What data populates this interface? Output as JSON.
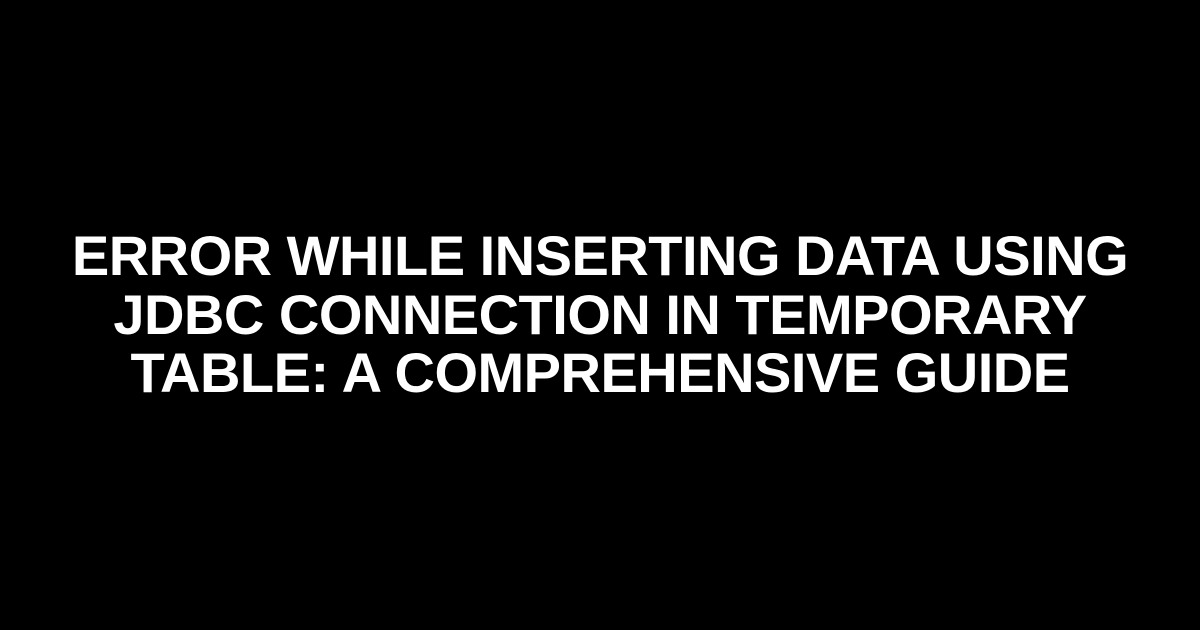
{
  "title": "ERROR WHILE INSERTING DATA USING JDBC CONNECTION IN TEMPORARY TABLE: A COMPREHENSIVE GUIDE"
}
